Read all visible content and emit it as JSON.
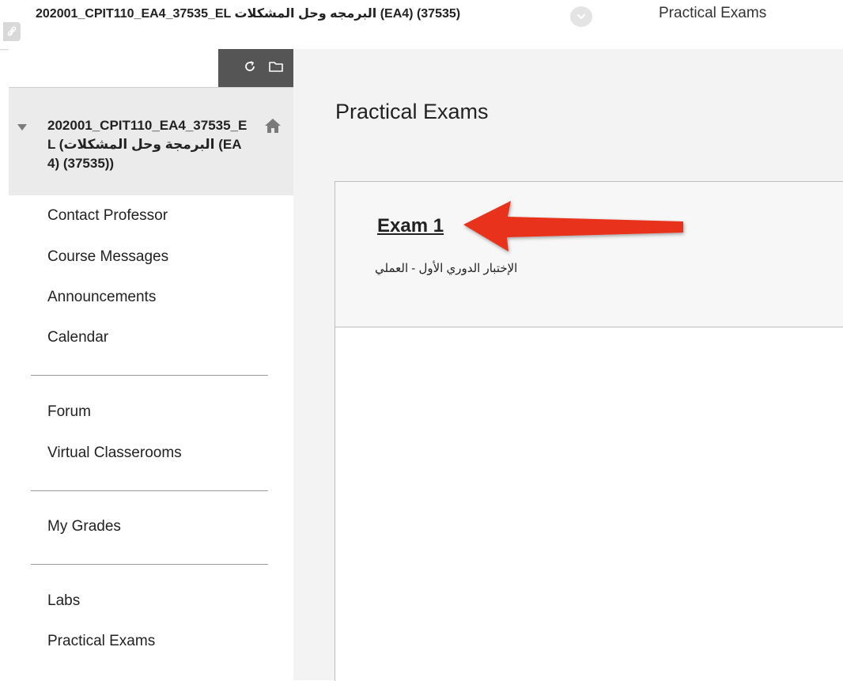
{
  "breadcrumb": {
    "course": "202001_CPIT110_EA4_37535_EL البرمجه وحل المشكلات (EA4) (37535)",
    "current": "Practical Exams"
  },
  "sidebar": {
    "course_title": "202001_CPIT110_EA4_37535_EL (البرمجة وحل المشكلات (EA4) (37535))",
    "groups": [
      {
        "items": [
          {
            "label": "Contact Professor"
          },
          {
            "label": "Course Messages"
          },
          {
            "label": "Announcements"
          },
          {
            "label": "Calendar"
          }
        ]
      },
      {
        "items": [
          {
            "label": "Forum"
          },
          {
            "label": "Virtual Classerooms"
          }
        ]
      },
      {
        "items": [
          {
            "label": "My Grades"
          }
        ]
      },
      {
        "items": [
          {
            "label": "Labs"
          },
          {
            "label": "Practical Exams"
          }
        ]
      }
    ]
  },
  "main": {
    "page_title": "Practical Exams",
    "items": [
      {
        "title": "Exam 1",
        "description": "الإختبار الدوري الأول - العملي"
      }
    ]
  },
  "icons": {
    "link_badge": "link-icon",
    "breadcrumb_toggle": "chevron-down-icon",
    "refresh": "refresh-icon",
    "folder": "folder-icon",
    "collapse": "caret-down-icon",
    "home": "home-icon",
    "annotation": "red-arrow-icon"
  },
  "colors": {
    "annotation_arrow": "#e8321f",
    "tool_box": "#555555",
    "course_head_bg": "#ebebeb",
    "content_bg": "#f3f3f3"
  }
}
